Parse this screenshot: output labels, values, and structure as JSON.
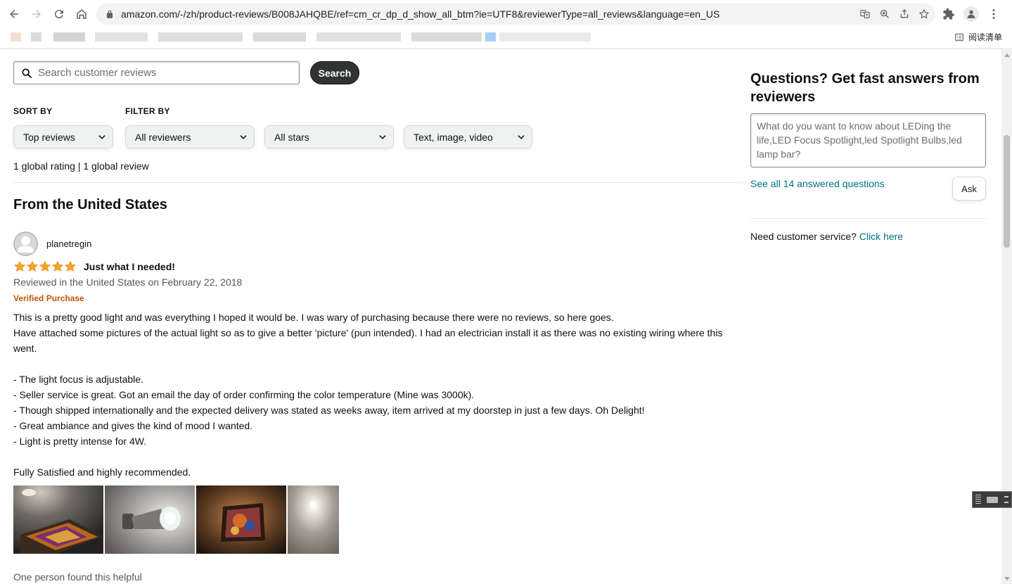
{
  "browser": {
    "url": "amazon.com/-/zh/product-reviews/B008JAHQBE/ref=cm_cr_dp_d_show_all_btm?ie=UTF8&reviewerType=all_reviews&language=en_US",
    "reading_list_label": "阅读清单"
  },
  "search": {
    "placeholder": "Search customer reviews",
    "button_label": "Search"
  },
  "sort": {
    "label": "SORT BY",
    "selected": "Top reviews"
  },
  "filter": {
    "label": "FILTER BY",
    "reviewers": "All reviewers",
    "stars": "All stars",
    "media": "Text, image, video"
  },
  "summary": "1 global rating | 1 global review",
  "section_title": "From the United States",
  "review": {
    "reviewer": "planetregin",
    "rating": 5,
    "title": "Just what I needed!",
    "date": "Reviewed in the United States on February 22, 2018",
    "badge": "Verified Purchase",
    "body": [
      "This is a pretty good light and was everything I hoped it would be. I was wary of purchasing because there were no reviews, so here goes.",
      "Have attached some pictures of the actual light so as to give a better 'picture' (pun intended). I had an electrician install it as there was no existing wiring where this went.",
      "",
      "- The light focus is adjustable.",
      "- Seller service is great. Got an email the day of order confirming the color temperature (Mine was 3000k).",
      "- Though shipped internationally and the expected delivery was stated as weeks away, item arrived at my doorstep in just a few days. Oh Delight!",
      "- Great ambiance and gives the kind of mood I wanted.",
      "- Light is pretty intense for 4W.",
      "",
      "Fully Satisfied and highly recommended."
    ],
    "helpful": "One person found this helpful"
  },
  "questions": {
    "title": "Questions? Get fast answers from reviewers",
    "placeholder": "What do you want to know about LEDing the life,LED Focus Spotlight,led Spotlight Bulbs,led lamp bar?",
    "see_all": "See all 14 answered questions",
    "ask_label": "Ask",
    "cs_text": "Need customer service?",
    "cs_link": "Click here"
  },
  "colors": {
    "star": "#FFA41C",
    "link": "#007185",
    "verified": "#C45500"
  }
}
